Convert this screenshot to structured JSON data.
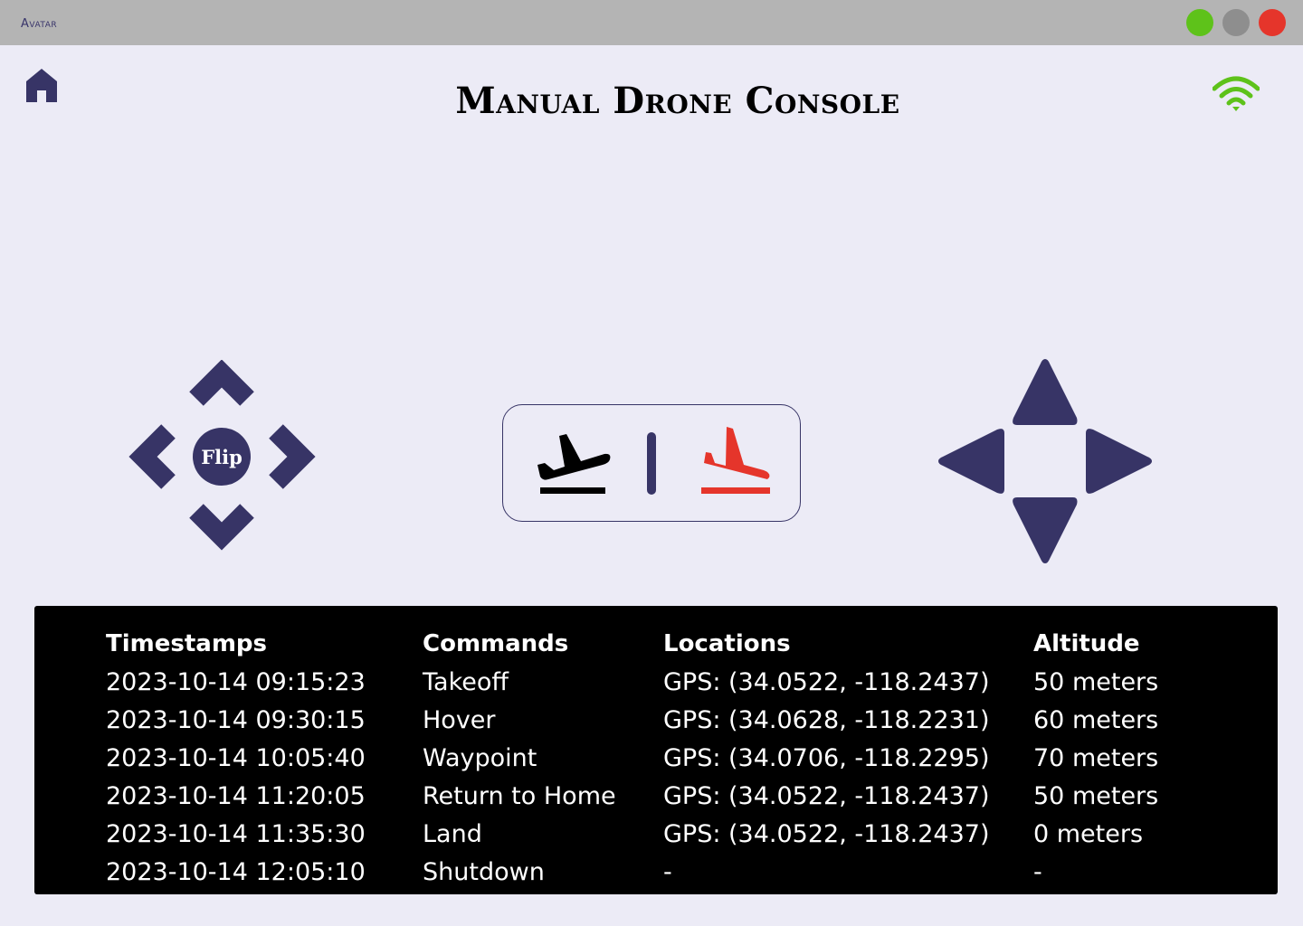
{
  "window": {
    "app_name": "Avatar",
    "controls": [
      "minimize",
      "maximize",
      "close"
    ],
    "colors": {
      "minimize": "#5ec21a",
      "maximize": "#8e8e8e",
      "close": "#e5352b"
    }
  },
  "header": {
    "title": "Manual Drone Console",
    "home_icon": "home-icon",
    "connection_icon": "wifi-icon",
    "connection_color": "#5ec21a"
  },
  "controls": {
    "flip_label": "Flip",
    "left_pad": [
      "chevron-up-icon",
      "chevron-left-icon",
      "chevron-right-icon",
      "chevron-down-icon"
    ],
    "right_pad": [
      "triangle-up-icon",
      "triangle-left-icon",
      "triangle-right-icon",
      "triangle-down-icon"
    ],
    "takeoff_icon": "flight-takeoff-icon",
    "land_icon": "flight-land-icon",
    "accent": "#373466",
    "land_color": "#e5352b"
  },
  "log": {
    "headers": [
      "Timestamps",
      "Commands",
      "Locations",
      "Altitude"
    ],
    "rows": [
      [
        "2023-10-14 09:15:23",
        "Takeoff",
        "GPS: (34.0522, -118.2437)",
        "50 meters"
      ],
      [
        "2023-10-14 09:30:15",
        "Hover",
        "GPS: (34.0628, -118.2231)",
        "60 meters"
      ],
      [
        "2023-10-14 10:05:40",
        "Waypoint",
        "GPS: (34.0706, -118.2295)",
        "70 meters"
      ],
      [
        "2023-10-14 11:20:05",
        "Return to Home",
        "GPS: (34.0522, -118.2437)",
        "50 meters"
      ],
      [
        "2023-10-14 11:35:30",
        "Land",
        "GPS: (34.0522, -118.2437)",
        "0 meters"
      ],
      [
        "2023-10-14 12:05:10",
        "Shutdown",
        "-",
        "-"
      ]
    ]
  }
}
